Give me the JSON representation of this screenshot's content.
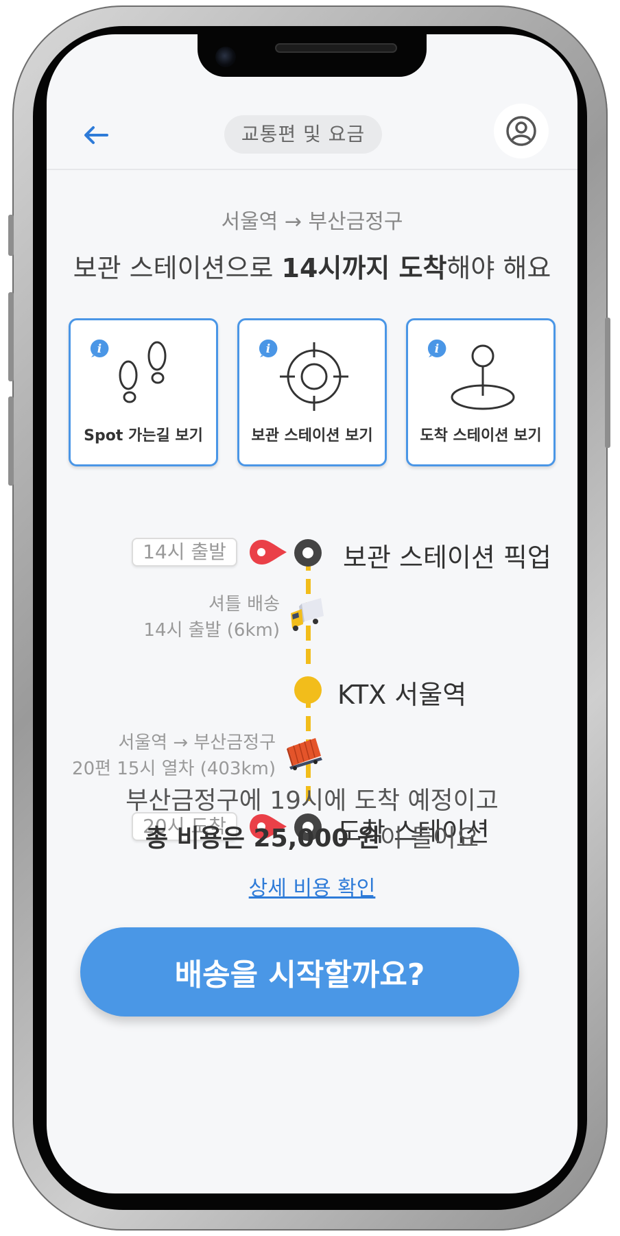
{
  "header": {
    "title": "교통편 및 요금",
    "back_icon": "arrow-left-icon",
    "profile_icon": "user-circle-icon"
  },
  "summary": {
    "route": "서울역 → 부산금정구",
    "headline_prefix": "보관 스테이션으로 ",
    "headline_bold": "14시까지 도착",
    "headline_suffix": "해야 해요"
  },
  "cards": [
    {
      "label": "Spot 가는길 보기",
      "icon": "footprints-icon"
    },
    {
      "label": "보관 스테이션 보기",
      "icon": "crosshair-target-icon"
    },
    {
      "label": "도착 스테이션 보기",
      "icon": "map-pin-stand-icon"
    }
  ],
  "timeline": {
    "stops": [
      {
        "time": "14시 출발",
        "label": "보관 스테이션 픽업"
      },
      {
        "label": "KTX 서울역"
      },
      {
        "time": "20시 도착",
        "label": "도착 스테이션"
      }
    ],
    "segments": [
      {
        "line1": "셔틀 배송",
        "line2": "14시 출발 (6km)",
        "vehicle": "truck-icon"
      },
      {
        "line1": "서울역 → 부산금정구",
        "line2": "20편 15시 열차 (403km)",
        "vehicle": "freight-train-icon"
      }
    ]
  },
  "arrival": {
    "line1": "부산금정구에 19시에 도착 예정이고",
    "line2_bold": "총 비용은 25,000 원",
    "line2_suffix": "이 들어요"
  },
  "detail_link": "상세 비용 확인",
  "start_button": "배송을 시작할까요?",
  "colors": {
    "accent": "#4a97e6",
    "link": "#2e7bd8",
    "route_line": "#f2bd1b",
    "pin": "#ea4048",
    "background": "#f6f7f9"
  }
}
